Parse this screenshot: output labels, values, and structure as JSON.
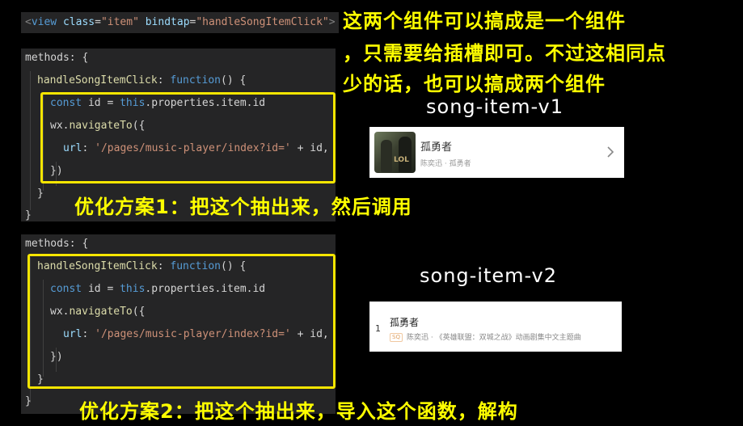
{
  "top_snippet": {
    "open_tag": "<",
    "tag": "view",
    "attr1_name": "class",
    "eq": "=",
    "attr1_value": "\"item\"",
    "attr2_name": "bindtap",
    "attr2_value": "\"handleSongItemClick\"",
    "close_tag": ">"
  },
  "code_block_1": {
    "line1": "methods: {",
    "fn_name": "handleSongItemClick",
    "fn_sep": ": ",
    "fn_kw": "function",
    "fn_tail": "() {",
    "const_kw": "const",
    "const_mid": " id = ",
    "this_kw": "this",
    "const_tail": ".properties.item.id",
    "wx": "wx.",
    "nav": "navigateTo",
    "nav_tail": "({",
    "url_key": "url",
    "url_sep": ": ",
    "url_value": "'/pages/music-player/index?id='",
    "url_tail": " + id,",
    "close_call": "})",
    "close_fn": "}",
    "close_methods": "}"
  },
  "code_block_2": {
    "line1": "methods: {",
    "fn_name": "handleSongItemClick",
    "fn_sep": ": ",
    "fn_kw": "function",
    "fn_tail": "() {",
    "const_kw": "const",
    "const_mid": " id = ",
    "this_kw": "this",
    "const_tail": ".properties.item.id",
    "wx": "wx.",
    "nav": "navigateTo",
    "nav_tail": "({",
    "url_key": "url",
    "url_sep": ": ",
    "url_value": "'/pages/music-player/index?id='",
    "url_tail": " + id,",
    "close_call": "})",
    "close_fn": "}",
    "close_methods": "}"
  },
  "notes": {
    "merge_line1": "这两个组件可以搞成是一个组件",
    "merge_line2": "，只需要给插槽即可。不过这相同点",
    "merge_line3": "少的话，也可以搞成两个组件",
    "v1_title": "song-item-v1",
    "v2_title": "song-item-v2",
    "plan1": "优化方案1：把这个抽出来，然后调用",
    "plan2": "优化方案2：把这个抽出来，导入这个函数，解构"
  },
  "song_item_v1": {
    "name": "孤勇者",
    "meta": "陈奕迅 · 孤勇者",
    "cover_text": "LOL"
  },
  "song_item_v2": {
    "index": "1",
    "name": "孤勇者",
    "tag": "SQ",
    "meta": "陈奕迅 · 《英雄联盟：双城之战》动画剧集中文主题曲"
  },
  "colors": {
    "highlight": "#f7e600",
    "annotation": "#ffff00",
    "code_bg": "#252526"
  }
}
